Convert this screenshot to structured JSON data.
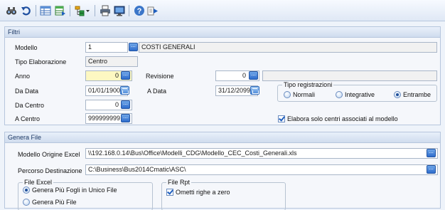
{
  "toolbar": {
    "icons": [
      "binoculars-icon",
      "undo-icon",
      "grid-icon",
      "excel-export-icon",
      "tree-dropdown-icon",
      "print-icon",
      "monitor-icon",
      "help-icon",
      "run-icon"
    ]
  },
  "filters": {
    "title": "Filtri",
    "modello": {
      "label": "Modello",
      "value": "1",
      "description": "COSTI GENERALI"
    },
    "tipo_elaborazione": {
      "label": "Tipo Elaborazione",
      "value": "Centro"
    },
    "anno": {
      "label": "Anno",
      "value": "0"
    },
    "revisione": {
      "label": "Revisione",
      "value": "0",
      "description": ""
    },
    "da_data": {
      "label": "Da Data",
      "value": "01/01/1900"
    },
    "a_data": {
      "label": "A Data",
      "value": "31/12/2099"
    },
    "da_centro": {
      "label": "Da Centro",
      "value": "0"
    },
    "a_centro": {
      "label": "A Centro",
      "value": "999999999"
    },
    "tipo_registrazioni": {
      "title": "Tipo registrazioni",
      "options": [
        "Normali",
        "Integrative",
        "Entrambe"
      ],
      "selected": "Entrambe"
    },
    "elabora_centri": {
      "label": "Elabora solo centri associati al modello",
      "checked": true
    }
  },
  "genera": {
    "title": "Genera File",
    "modello_origine": {
      "label": "Modello Origine Excel",
      "value": "\\\\192.168.0.14\\Bus\\Office\\Modelli_CDG\\Modello_CEC_Costi_Generali.xls"
    },
    "percorso": {
      "label": "Percorso Destinazione",
      "value": "C:\\Business\\Bus2014Cmatic\\ASC\\"
    },
    "file_excel": {
      "title": "File Excel",
      "options": [
        "Genera Più Fogli in Unico File",
        "Genera Più File"
      ],
      "selected": "Genera Più Fogli in Unico File"
    },
    "file_rpt": {
      "title": "File Rpt",
      "ometti": {
        "label": "Ometti righe a zero",
        "checked": true
      }
    }
  },
  "colors": {
    "accent": "#2d6ccc",
    "panel_header": "#cfdcee",
    "yellow_field": "#fdf8c2"
  }
}
